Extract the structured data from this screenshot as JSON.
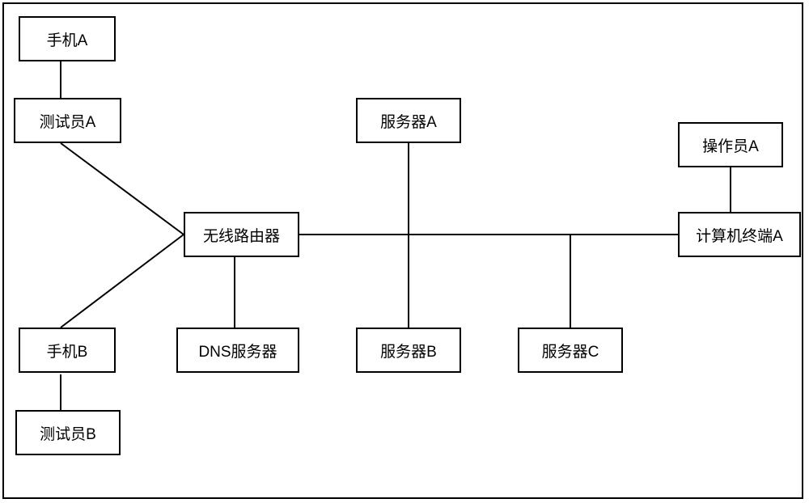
{
  "nodes": {
    "phoneA": "手机A",
    "testerA": "测试员A",
    "phoneB": "手机B",
    "testerB": "测试员B",
    "router": "无线路由器",
    "dnsServer": "DNS服务器",
    "serverA": "服务器A",
    "serverB": "服务器B",
    "serverC": "服务器C",
    "operatorA": "操作员A",
    "terminalA": "计算机终端A"
  }
}
